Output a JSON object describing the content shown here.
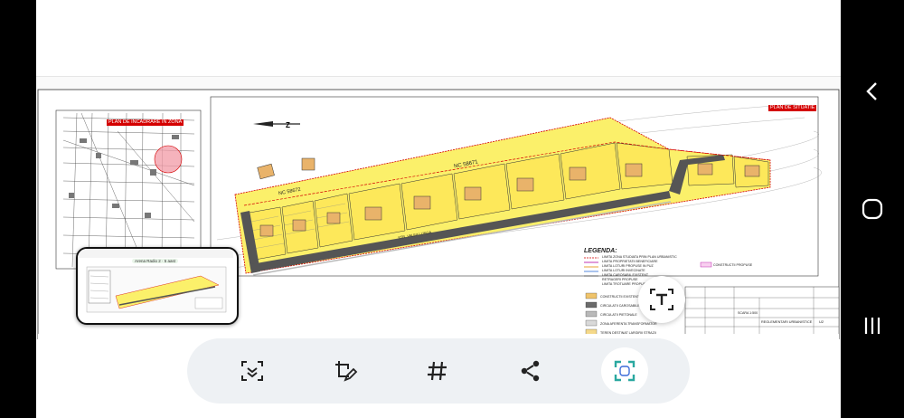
{
  "viewer": {
    "thumbnail_caption": "Arena Radio 2 · 5 aast"
  },
  "drawing": {
    "location_plan_title": "PLAN DE INCADRARE IN ZONA",
    "site_plan_title": "PLAN DE SITUATIE",
    "parcel_main": "NC 58671",
    "parcel_secondary": "NC 58672",
    "legend_title": "LEGENDA:",
    "legend_lines": [
      "LIMITA ZONA STUDIATA PRIN PLAN URBANISTIC",
      "LIMITA PROPRIETATII BENEFICIARE",
      "LIMITA LOTURI PROPUSE IN PUZ",
      "LIMITA LOTURI INVECINATE",
      "LIMITA CAROSABIL EXISTENT",
      "RETRAGERI PROPUSE",
      "LIMITA TROTUARE PROPUSE"
    ],
    "legend_swatches": [
      {
        "label": "CONSTRUCTII EXISTENTE",
        "color": "#f0c46b"
      },
      {
        "label": "CIRCULATII CAROSABILE",
        "color": "#6b6b6b"
      },
      {
        "label": "CIRCULATII PIETONALE",
        "color": "#b9b9b9"
      },
      {
        "label": "ZONA AFERENTA TRANSFORMATOR",
        "color": "#d9d9d9"
      },
      {
        "label": "TEREN DESTINAT LARGIRII STRAZII",
        "color": "#f5d98a"
      }
    ],
    "legend_right": "CONSTRUCTII PROPUSE",
    "street_label": "STR. VALEA LUNGA",
    "titleblock_plan": "REGLEMENTARI URBANISTICE",
    "titleblock_sheet": "U2",
    "scale_label": "SCARA 1:500",
    "colors": {
      "site_yellow": "#fbf06a",
      "lot_yellow": "#fde85a",
      "road_gray": "#555555",
      "red_boundary": "#d40000",
      "building": "#e9b36a"
    }
  },
  "toolbar": {
    "buttons": [
      {
        "name": "scan-text-icon"
      },
      {
        "name": "edit-crop-icon"
      },
      {
        "name": "hashtag-icon"
      },
      {
        "name": "share-icon"
      },
      {
        "name": "smart-select-icon"
      }
    ]
  },
  "navigation": {
    "back": "back-icon",
    "home": "home-icon",
    "recents": "recents-icon"
  }
}
